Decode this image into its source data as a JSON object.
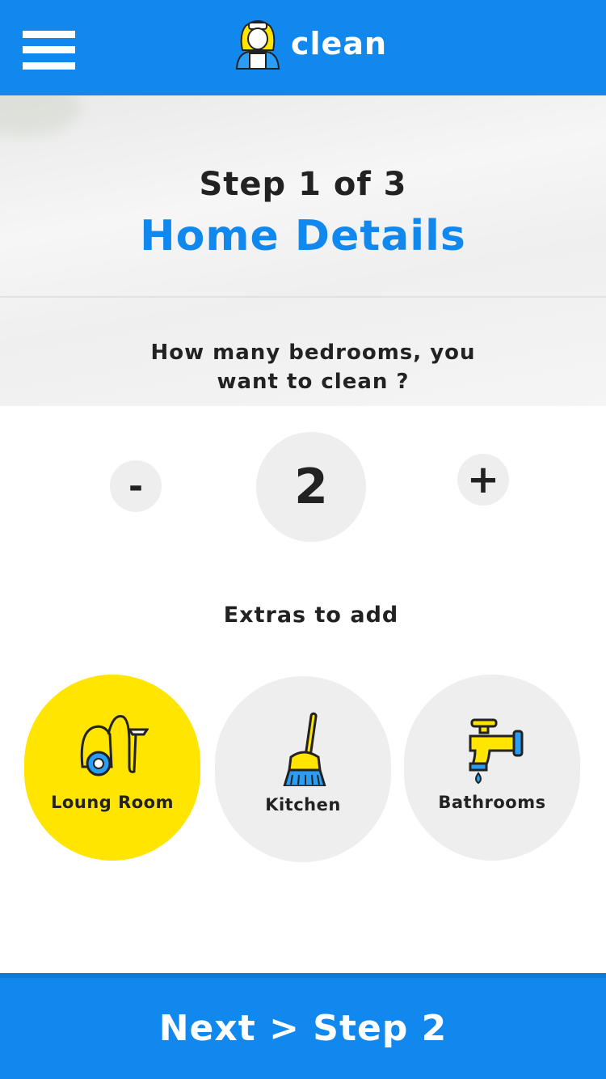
{
  "header": {
    "app_name": "clean",
    "menu_icon": "hamburger-menu-icon",
    "logo_icon": "maid-avatar-icon",
    "background_color": "#1188ee"
  },
  "wizard": {
    "step_label": "Step 1 of 3",
    "title": "Home Details"
  },
  "bedrooms": {
    "question": "How many bedrooms, you want to clean ?",
    "decrement_label": "-",
    "count": "2",
    "increment_label": "+"
  },
  "extras": {
    "title": "Extras to add",
    "items": [
      {
        "label": "Loung Room",
        "icon": "vacuum-cleaner-icon",
        "selected": true
      },
      {
        "label": "Kitchen",
        "icon": "broom-icon",
        "selected": false
      },
      {
        "label": "Bathrooms",
        "icon": "water-tap-icon",
        "selected": false
      }
    ]
  },
  "footer": {
    "next_label": "Next > Step 2"
  },
  "colors": {
    "accent_blue": "#1188ee",
    "selected_yellow": "#ffe500",
    "neutral_gray": "#eeeeee"
  }
}
